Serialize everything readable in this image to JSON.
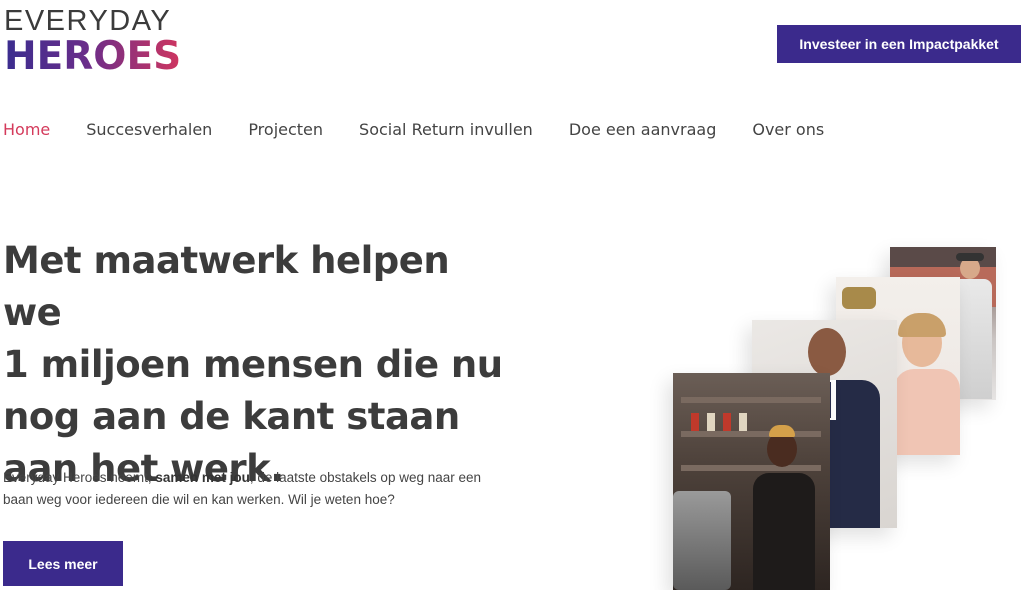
{
  "logo": {
    "line1": "EVERYDAY",
    "line2": "HEROES"
  },
  "header": {
    "cta_label": "Investeer in een Impactpakket"
  },
  "nav": {
    "items": [
      {
        "label": "Home",
        "active": true
      },
      {
        "label": "Succesverhalen",
        "active": false
      },
      {
        "label": "Projecten",
        "active": false
      },
      {
        "label": "Social Return invullen",
        "active": false
      },
      {
        "label": "Doe een aanvraag",
        "active": false
      },
      {
        "label": "Over ons",
        "active": false
      }
    ]
  },
  "hero": {
    "headline_lines": [
      "Met maatwerk helpen we",
      "1 miljoen mensen die nu",
      "nog aan de kant staan",
      "aan het werk."
    ],
    "lead_before": "Everyday Heroes neemt, ",
    "lead_bold": "samen met jou",
    "lead_after": ", de laatste obstakels op weg naar een baan weg voor iedereen die wil en kan werken. Wil je weten hoe?",
    "cta_label": "Lees meer"
  },
  "colors": {
    "brand_purple": "#3b2a8c",
    "brand_pink": "#d43a5b",
    "text_dark": "#3c3c3c"
  }
}
